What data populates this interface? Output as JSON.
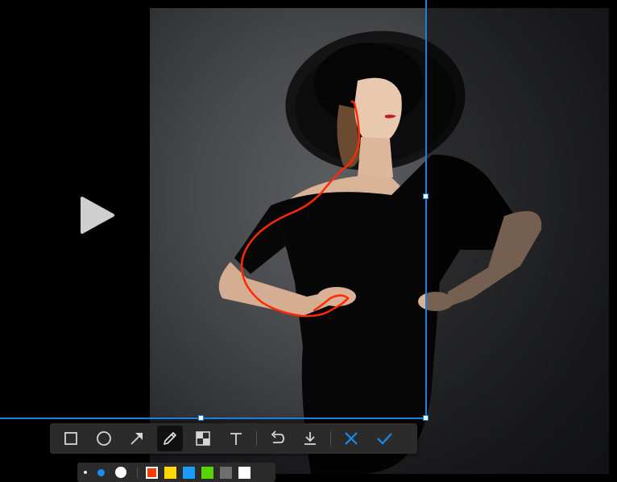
{
  "screen": {
    "background": "#000000"
  },
  "photo": {
    "description_icon": "portrait-photo"
  },
  "selection": {
    "color": "#1a7fe0"
  },
  "annotation": {
    "pen_color": "#ff2a00"
  },
  "toolbar": {
    "tools": [
      {
        "id": "rectangle",
        "icon": "rectangle-icon",
        "active": false
      },
      {
        "id": "ellipse",
        "icon": "ellipse-icon",
        "active": false
      },
      {
        "id": "arrow",
        "icon": "arrow-icon",
        "active": false
      },
      {
        "id": "pen",
        "icon": "pen-icon",
        "active": true
      },
      {
        "id": "mosaic",
        "icon": "mosaic-icon",
        "active": false
      },
      {
        "id": "text",
        "icon": "text-icon",
        "active": false
      },
      {
        "id": "undo",
        "icon": "undo-icon",
        "active": false
      },
      {
        "id": "download",
        "icon": "download-icon",
        "active": false
      },
      {
        "id": "cancel",
        "icon": "close-icon",
        "active": false
      },
      {
        "id": "confirm",
        "icon": "check-icon",
        "active": false
      }
    ],
    "accent": "#1a8cf0"
  },
  "subbar": {
    "sizes": [
      "small",
      "medium",
      "large"
    ],
    "selected_size": "medium",
    "selected_size_color": "#1a8cf0",
    "colors": [
      "#ff3b00",
      "#ffd800",
      "#1a9cff",
      "#58d400",
      "#6e6e6e",
      "#ffffff"
    ],
    "selected_color": "#ff3b00"
  }
}
